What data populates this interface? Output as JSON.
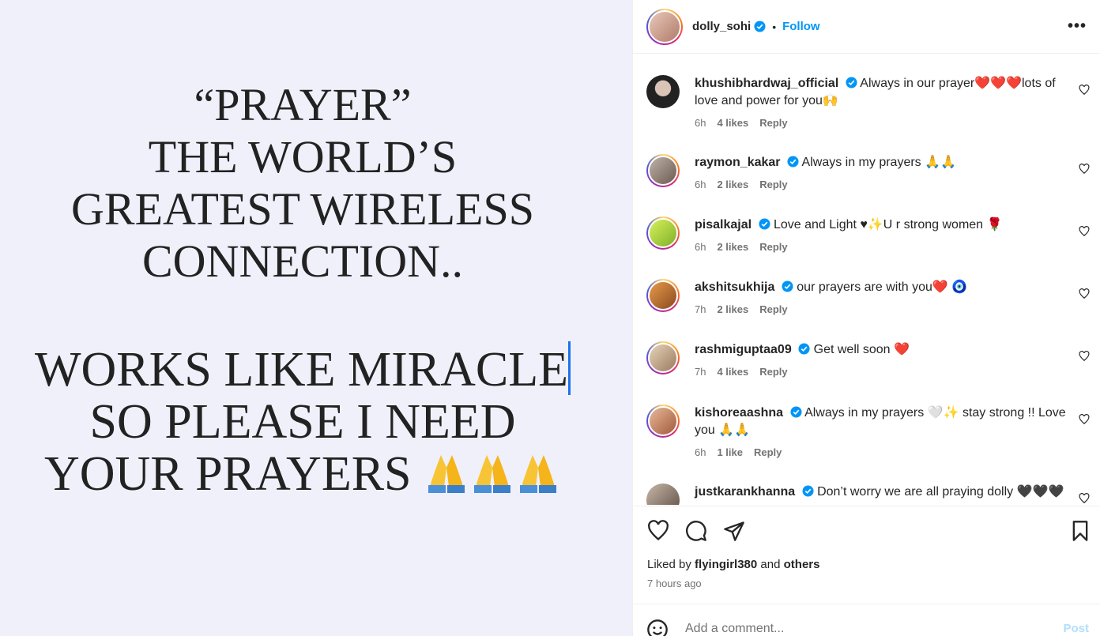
{
  "image": {
    "block1": [
      "“PRAYER”",
      "THE WORLD’S",
      "GREATEST WIRELESS",
      "CONNECTION.."
    ],
    "block2": [
      "WORKS LIKE MIRACLE",
      "SO PLEASE I NEED",
      "YOUR PRAYERS"
    ]
  },
  "header": {
    "username": "dolly_sohi",
    "dot": "•",
    "follow": "Follow",
    "more": "•••"
  },
  "comments": [
    {
      "user": "khushibhardwaj_official",
      "text": "Always in our prayer❤️❤️❤️lots of love and power for you🙌",
      "time": "6h",
      "likes": "4 likes",
      "reply": "Reply"
    },
    {
      "user": "raymon_kakar",
      "text": "Always in my prayers 🙏🙏",
      "time": "6h",
      "likes": "2 likes",
      "reply": "Reply"
    },
    {
      "user": "pisalkajal",
      "text": "Love and Light ♥✨U r strong women 🌹",
      "time": "6h",
      "likes": "2 likes",
      "reply": "Reply"
    },
    {
      "user": "akshitsukhija",
      "text": "our prayers are with you❤️ 🧿",
      "time": "7h",
      "likes": "2 likes",
      "reply": "Reply"
    },
    {
      "user": "rashmiguptaa09",
      "text": "Get well soon ❤️",
      "time": "7h",
      "likes": "4 likes",
      "reply": "Reply"
    },
    {
      "user": "kishoreaashna",
      "text": "Always in my prayers 🤍✨ stay strong !! Love you 🙏🙏",
      "time": "6h",
      "likes": "1 like",
      "reply": "Reply"
    },
    {
      "user": "justkarankhanna",
      "text": "Don’t worry we are all praying dolly 🖤🖤🖤",
      "time": "",
      "likes": "",
      "reply": ""
    }
  ],
  "footer": {
    "liked_prefix": "Liked by",
    "liked_user": "flyingirl380",
    "liked_and": "and",
    "liked_others": "others",
    "time_ago": "7 hours ago",
    "add_placeholder": "Add a comment...",
    "post": "Post"
  },
  "colors": {
    "accent": "#0095f6",
    "verified": "#0095f6",
    "image_bg": "#f0f0fb"
  },
  "icons": [
    "heart-icon",
    "comment-icon",
    "share-icon",
    "bookmark-icon",
    "smiley-icon",
    "verified-icon",
    "more-icon"
  ]
}
